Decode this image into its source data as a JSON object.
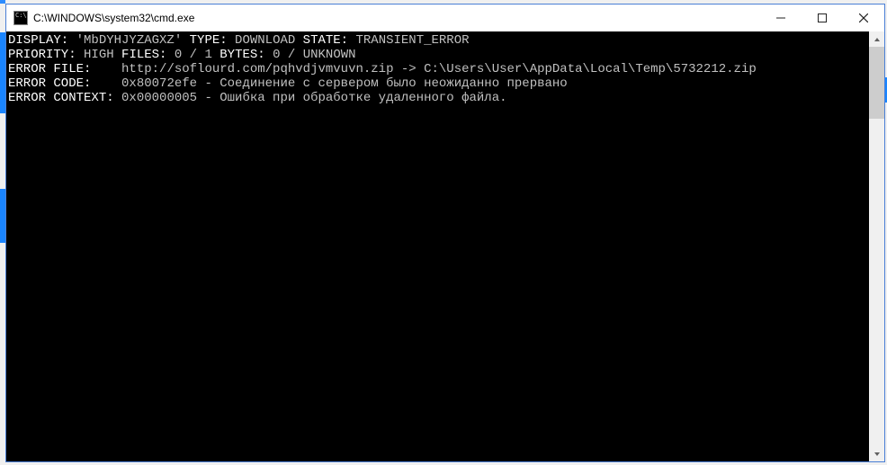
{
  "titlebar": {
    "icon_name": "cmd-icon",
    "title": "C:\\WINDOWS\\system32\\cmd.exe"
  },
  "console": {
    "line1": {
      "label_display": "DISPLAY:",
      "display_val": " 'MbDYHJYZAGXZ' ",
      "label_type": "TYPE:",
      "type_val": " DOWNLOAD ",
      "label_state": "STATE:",
      "state_val": " TRANSIENT_ERROR"
    },
    "line2": {
      "label_priority": "PRIORITY:",
      "priority_val": " HIGH ",
      "label_files": "FILES:",
      "files_val": " 0 / 1 ",
      "label_bytes": "BYTES:",
      "bytes_val": " 0 / UNKNOWN"
    },
    "line3": {
      "label": "ERROR FILE:    ",
      "val": "http://soflourd.com/pqhvdjvmvuvn.zip -> C:\\Users\\User\\AppData\\Local\\Temp\\5732212.zip"
    },
    "line4": {
      "label": "ERROR CODE:    ",
      "val": "0x80072efe - Соединение с сервером было неожиданно прервано"
    },
    "line5": {
      "label": "ERROR CONTEXT: ",
      "val": "0x00000005 - Ошибка при обработке удаленного файла."
    }
  }
}
